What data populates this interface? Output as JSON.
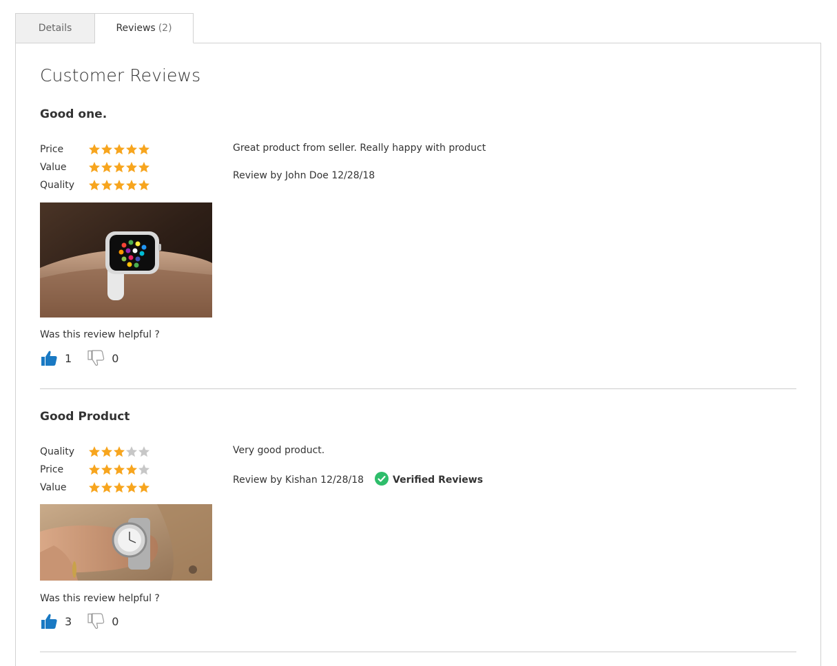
{
  "tabs": {
    "details_label": "Details",
    "reviews_label": "Reviews",
    "reviews_count": "(2)"
  },
  "page_title": "Customer Reviews",
  "helpful_question": "Was this review helpful ?",
  "colors": {
    "star_filled": "#f7a51e",
    "star_empty": "#c7c7c7",
    "thumb_up": "#1979c3",
    "verified_badge": "#2ebd6b"
  },
  "reviews": [
    {
      "title": "Good one.",
      "ratings": [
        {
          "label": "Price",
          "stars": 5
        },
        {
          "label": "Value",
          "stars": 5
        },
        {
          "label": "Quality",
          "stars": 5
        }
      ],
      "photo": "smartwatch-on-wrist",
      "text": "Great product from seller. Really happy with product",
      "meta": "Review by John Doe 12/28/18",
      "verified": "",
      "helpful_yes": "1",
      "helpful_no": "0"
    },
    {
      "title": "Good Product",
      "ratings": [
        {
          "label": "Quality",
          "stars": 3
        },
        {
          "label": "Price",
          "stars": 4
        },
        {
          "label": "Value",
          "stars": 5
        }
      ],
      "photo": "silver-watch-on-wrist",
      "text": "Very good product.",
      "meta": "Review by Kishan 12/28/18",
      "verified": "Verified Reviews",
      "helpful_yes": "3",
      "helpful_no": "0"
    }
  ]
}
